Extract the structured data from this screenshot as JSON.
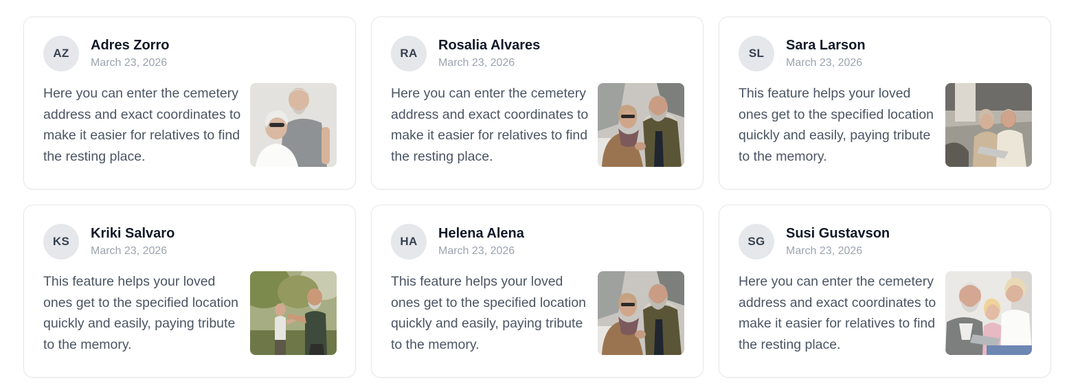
{
  "cards": [
    {
      "initials": "AZ",
      "name": "Adres Zorro",
      "date": "March 23, 2026",
      "text": "Here you can enter the cemetery address and exact coordinates to make it easier for relatives to find the resting place.",
      "photo": "elderly-couple-photo"
    },
    {
      "initials": "RA",
      "name": "Rosalia Alvares",
      "date": "March 23, 2026",
      "text": "Here you can enter the cemetery address and exact coordinates to make it easier for relatives to find the resting place.",
      "photo": "couple-winter-photo"
    },
    {
      "initials": "SL",
      "name": "Sara Larson",
      "date": "March 23, 2026",
      "text": "This feature helps your loved ones get to the specified location quickly and easily, paying tribute to the memory.",
      "photo": "couple-laptop-photo"
    },
    {
      "initials": "KS",
      "name": "Kriki Salvaro",
      "date": "March 23, 2026",
      "text": "This feature helps your loved ones get to the specified location quickly and easily, paying tribute to the memory.",
      "photo": "couple-exercise-photo"
    },
    {
      "initials": "HA",
      "name": "Helena Alena",
      "date": "March 23, 2026",
      "text": "This feature helps your loved ones get to the specified location quickly and easily, paying tribute to the memory.",
      "photo": "couple-winter-photo"
    },
    {
      "initials": "SG",
      "name": "Susi Gustavson",
      "date": "March 23, 2026",
      "text": "Here you can enter the cemetery address and exact coordinates to make it easier for relatives to find the resting place.",
      "photo": "grandparents-child-photo"
    }
  ]
}
